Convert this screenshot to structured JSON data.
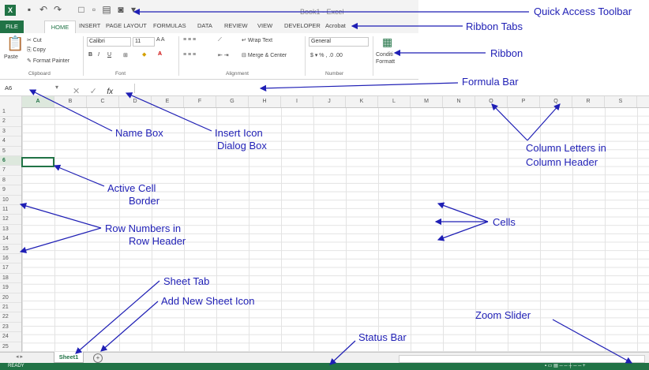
{
  "window": {
    "title": "Book1 - Excel"
  },
  "tabs": [
    {
      "id": "file",
      "label": "FILE"
    },
    {
      "id": "home",
      "label": "HOME"
    },
    {
      "id": "insert",
      "label": "INSERT"
    },
    {
      "id": "page-layout",
      "label": "PAGE LAYOUT"
    },
    {
      "id": "formulas",
      "label": "FORMULAS"
    },
    {
      "id": "data",
      "label": "DATA"
    },
    {
      "id": "review",
      "label": "REVIEW"
    },
    {
      "id": "view",
      "label": "VIEW"
    },
    {
      "id": "developer",
      "label": "DEVELOPER"
    },
    {
      "id": "acrobat",
      "label": "Acrobat"
    }
  ],
  "ribbon": {
    "paste": "Paste",
    "cut": "Cut",
    "copy": "Copy",
    "format_painter": "Format Painter",
    "clipboard": "Clipboard",
    "font_name": "Calibri",
    "font_size": "11",
    "font_group": "Font",
    "wrap_text": "Wrap Text",
    "merge_center": "Merge & Center",
    "alignment": "Alignment",
    "number_format": "General",
    "number_group": "Number",
    "conditional": "Conditi",
    "conditional2": "Formatt"
  },
  "formula_bar": {
    "name_box": "A6",
    "fx": "fx"
  },
  "columns": [
    "A",
    "B",
    "C",
    "D",
    "E",
    "F",
    "G",
    "H",
    "I",
    "J",
    "K",
    "L",
    "M",
    "N",
    "O",
    "P",
    "Q",
    "R",
    "S"
  ],
  "rows": [
    "1",
    "2",
    "3",
    "4",
    "5",
    "6",
    "7",
    "8",
    "9",
    "10",
    "11",
    "12",
    "13",
    "14",
    "15",
    "16",
    "17",
    "18",
    "19",
    "20",
    "21",
    "22",
    "23",
    "24",
    "25"
  ],
  "sheet": {
    "tab": "Sheet1",
    "add": "+"
  },
  "status": {
    "ready": "READY"
  },
  "annotations": {
    "qat": "Quick Access Toolbar",
    "ribbon_tabs": "Ribbon Tabs",
    "ribbon": "Ribbon",
    "formula_bar": "Formula Bar",
    "name_box": "Name Box",
    "insert_icon_1": "Insert Icon",
    "insert_icon_2": "Dialog Box",
    "col_letters_1": "Column Letters in",
    "col_letters_2": "Column Header",
    "active_cell_1": "Active Cell",
    "active_cell_2": "Border",
    "row_numbers_1": "Row Numbers in",
    "row_numbers_2": "Row Header",
    "cells": "Cells",
    "sheet_tab": "Sheet Tab",
    "add_sheet": "Add New Sheet Icon",
    "zoom_slider": "Zoom Slider",
    "status_bar": "Status Bar"
  },
  "colors": {
    "excel_green": "#217346",
    "annotation_blue": "#1f1fb5"
  }
}
